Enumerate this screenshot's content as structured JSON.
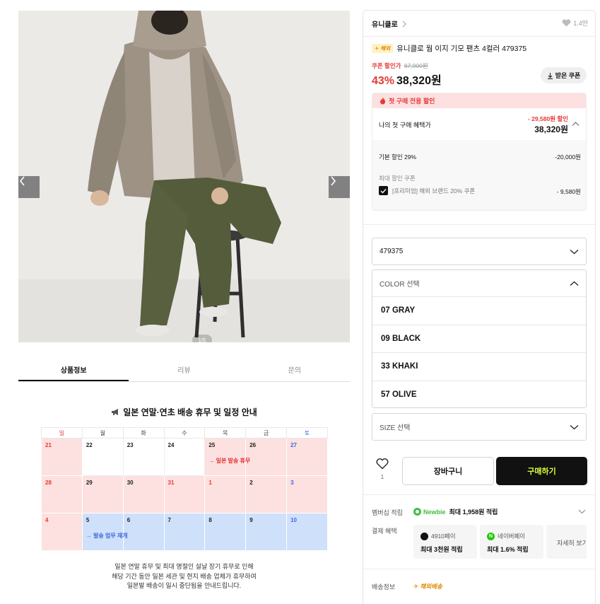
{
  "gallery": {
    "counter": "1/5"
  },
  "tabs": [
    "상품정보",
    "리뷰",
    "문의"
  ],
  "notice": {
    "title": "일본 연말·연초 배송 휴무 및 일정 안내",
    "weekdays": [
      "일",
      "월",
      "화",
      "수",
      "목",
      "금",
      "토"
    ],
    "weeks": [
      [
        {
          "d": "21",
          "bg": "pink",
          "c": "red"
        },
        {
          "d": "22",
          "bg": "white"
        },
        {
          "d": "23",
          "bg": "white"
        },
        {
          "d": "24",
          "bg": "white"
        },
        {
          "d": "25",
          "bg": "pink",
          "note": "→ 일본 발송 휴무",
          "noteColor": "red"
        },
        {
          "d": "26",
          "bg": "pink"
        },
        {
          "d": "27",
          "bg": "pink",
          "c": "blue"
        }
      ],
      [
        {
          "d": "28",
          "bg": "pink",
          "c": "red"
        },
        {
          "d": "29",
          "bg": "pink"
        },
        {
          "d": "30",
          "bg": "pink"
        },
        {
          "d": "31",
          "bg": "pink",
          "c": "red"
        },
        {
          "d": "1",
          "bg": "pink",
          "c": "red"
        },
        {
          "d": "2",
          "bg": "pink"
        },
        {
          "d": "3",
          "bg": "pink",
          "c": "blue"
        }
      ],
      [
        {
          "d": "4",
          "bg": "pink",
          "c": "red"
        },
        {
          "d": "5",
          "bg": "blue",
          "note": "→ 발송 업무 재개",
          "noteColor": "blue"
        },
        {
          "d": "6",
          "bg": "blue"
        },
        {
          "d": "7",
          "bg": "blue"
        },
        {
          "d": "8",
          "bg": "blue"
        },
        {
          "d": "9",
          "bg": "blue"
        },
        {
          "d": "10",
          "bg": "blue",
          "c": "blue"
        }
      ]
    ],
    "text": [
      "일본 연말 휴무 및 최대 명절인 설날 장기 휴무로 인해",
      "해당 기간 동안 일본 세관 및 현지 배송 업체가 휴무하여",
      "일본발 배송이 일시 중단됨을 안내드립니다."
    ]
  },
  "panel": {
    "brand": "유니클로",
    "likes": "1.4만",
    "overseas_badge": "해외",
    "product_title": "유니클로 웜 이지 기모 팬츠 4컬러 479375",
    "coupon_label": "쿠폰 할인가",
    "original_price": "67,900원",
    "discount_rate": "43%",
    "price": "38,320원",
    "coupon_button": "받은 쿠폰",
    "first_purchase": {
      "banner": "첫 구매 전용 할인",
      "label": "나의 첫 구매 혜택가",
      "discount": "- 29,580원 할인",
      "price": "38,320원",
      "basic_label": "기본 할인 29%",
      "basic_value": "-20,000원",
      "max_coupon_label": "최대 할인 쿠폰",
      "coupon_name": "[프리미엄] 해외 브랜드 20% 쿠폰",
      "coupon_value": "- 9,580원"
    },
    "model_select": "479375",
    "color_select": {
      "placeholder": "COLOR 선택",
      "options": [
        "07 GRAY",
        "09 BLACK",
        "33 KHAKI",
        "57 OLIVE"
      ]
    },
    "size_select": "SIZE 선택",
    "wish_count": "1",
    "cart_button": "장바구니",
    "buy_button": "구매하기",
    "membership": {
      "label": "멤버십 적립",
      "grade": "Newbie",
      "value": "최대 1,958원 적립"
    },
    "payment": {
      "label": "결제 혜택",
      "cards": [
        {
          "name": "4910페이",
          "value": "최대 3천원 적립"
        },
        {
          "name": "네이버페이",
          "value": "최대 1.6% 적립"
        }
      ],
      "more": "자세히 보기"
    },
    "shipping": {
      "label": "배송정보",
      "value": "해외배송"
    }
  },
  "colors": {
    "accent_red": "#e53935",
    "buy_bg": "#111111",
    "buy_text": "#d8ff3a",
    "newbie_green": "#3fbf3f",
    "naver_green": "#1ec800"
  }
}
